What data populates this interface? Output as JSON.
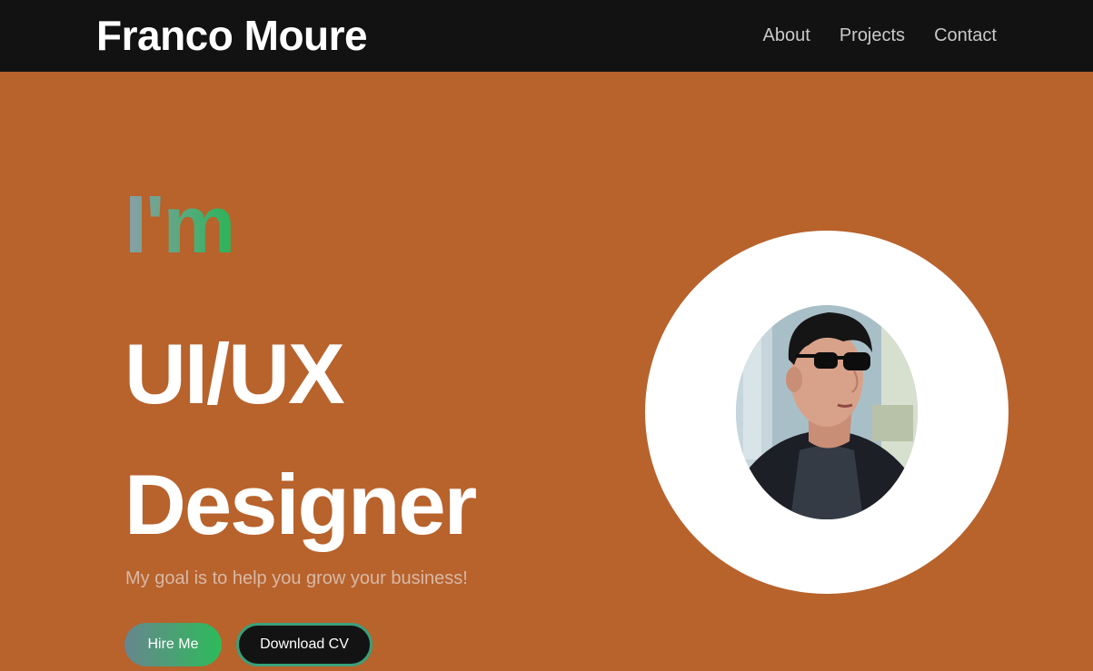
{
  "header": {
    "brand": "Franco Moure",
    "nav": [
      "About",
      "Projects",
      "Contact"
    ]
  },
  "hero": {
    "intro": "I'm",
    "role_lines": [
      "UI/UX",
      "Designer"
    ],
    "tagline": "My goal is to help you grow your business!",
    "buttons": {
      "hire": "Hire Me",
      "download": "Download CV"
    }
  },
  "colors": {
    "background": "#b8622c",
    "nav_background": "#121212",
    "accent_gradient_start": "#8a9fa9",
    "accent_gradient_end": "#2bb457",
    "avatar_ring": "#ffffff"
  },
  "icons": {
    "avatar": "profile-photo"
  }
}
